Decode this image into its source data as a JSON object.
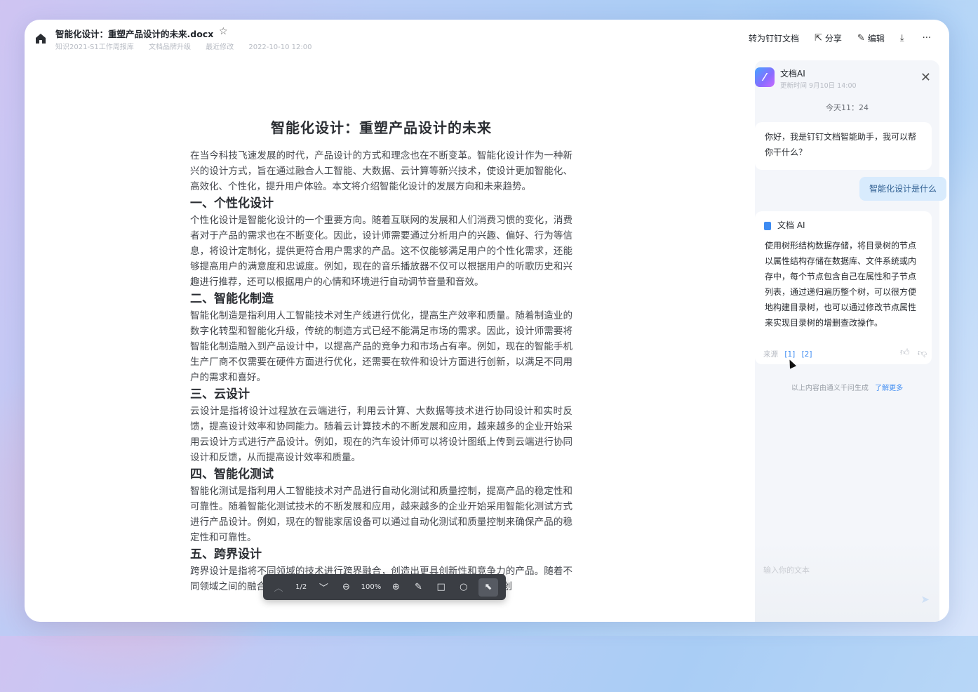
{
  "header": {
    "title": "智能化设计：重塑产品设计的未来.docx",
    "meta": [
      "知识2021-S1工作周报库",
      "文档品牌升级",
      "最近修改",
      "2022-10-10 12:00"
    ],
    "actions": {
      "convert": "转为钉钉文档",
      "share": "分享",
      "edit": "编辑"
    }
  },
  "document": {
    "title": "智能化设计：重塑产品设计的未来",
    "intro": "在当今科技飞速发展的时代，产品设计的方式和理念也在不断变革。智能化设计作为一种新兴的设计方式，旨在通过融合人工智能、大数据、云计算等新兴技术，使设计更加智能化、高效化、个性化，提升用户体验。本文将介绍智能化设计的发展方向和未来趋势。",
    "sections": [
      {
        "heading": "一、个性化设计",
        "body": "个性化设计是智能化设计的一个重要方向。随着互联网的发展和人们消费习惯的变化，消费者对于产品的需求也在不断变化。因此，设计师需要通过分析用户的兴趣、偏好、行为等信息，将设计定制化，提供更符合用户需求的产品。这不仅能够满足用户的个性化需求，还能够提高用户的满意度和忠诚度。例如，现在的音乐播放器不仅可以根据用户的听歌历史和兴趣进行推荐，还可以根据用户的心情和环境进行自动调节音量和音效。"
      },
      {
        "heading": "二、智能化制造",
        "body": "智能化制造是指利用人工智能技术对生产线进行优化，提高生产效率和质量。随着制造业的数字化转型和智能化升级，传统的制造方式已经不能满足市场的需求。因此，设计师需要将智能化制造融入到产品设计中，以提高产品的竞争力和市场占有率。例如，现在的智能手机生产厂商不仅需要在硬件方面进行优化，还需要在软件和设计方面进行创新，以满足不同用户的需求和喜好。"
      },
      {
        "heading": "三、云设计",
        "body": "云设计是指将设计过程放在云端进行，利用云计算、大数据等技术进行协同设计和实时反馈，提高设计效率和协同能力。随着云计算技术的不断发展和应用，越来越多的企业开始采用云设计方式进行产品设计。例如，现在的汽车设计师可以将设计图纸上传到云端进行协同设计和反馈，从而提高设计效率和质量。"
      },
      {
        "heading": "四、智能化测试",
        "body": "智能化测试是指利用人工智能技术对产品进行自动化测试和质量控制，提高产品的稳定性和可靠性。随着智能化测试技术的不断发展和应用，越来越多的企业开始采用智能化测试方式进行产品设计。例如，现在的智能家居设备可以通过自动化测试和质量控制来确保产品的稳定性和可靠性。"
      },
      {
        "heading": "五、跨界设计",
        "body": "跨界设计是指将不同领域的技术进行跨界融合，创造出更具创新性和竞争力的产品。随着不同领域之间的融合和交叉，设计师需要将不同领域的技术进行跨界融合，以创"
      }
    ]
  },
  "ai_panel": {
    "name": "文档AI",
    "subtitle": "更新时间 9月10日 14:00",
    "time": "今天11：24",
    "greeting": "你好，我是钉钉文档智能助手，我可以帮你干什么？",
    "user_message": "智能化设计是什么",
    "reply_label": "文档 AI",
    "reply_text": "使用树形结构数据存储，将目录树的节点以属性结构存储在数据库、文件系统或内存中，每个节点包含自己在属性和子节点列表，通过递归遍历整个树，可以很方便地构建目录树，也可以通过修改节点属性来实现目录树的增删查改操作。",
    "source_label": "来源",
    "refs": [
      "[1]",
      "[2]"
    ],
    "disclaimer": "以上内容由通义千问生成",
    "learn_more": "了解更多",
    "input_placeholder": "输入你的文本"
  },
  "toolbar": {
    "page": "1/2",
    "zoom": "100%"
  }
}
